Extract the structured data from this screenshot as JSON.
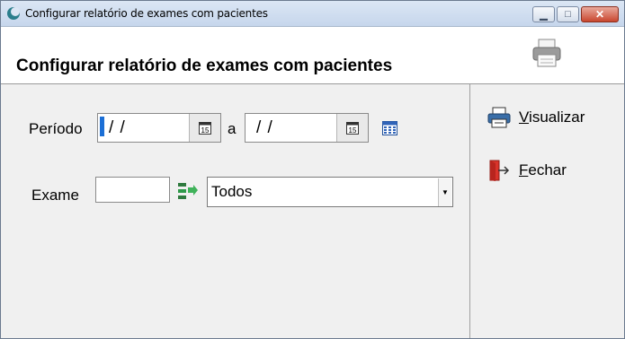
{
  "window": {
    "title": "Configurar relatório de exames com pacientes",
    "controls": {
      "minimize": "▁",
      "maximize": "□",
      "close": "✕"
    }
  },
  "header": {
    "title": "Configurar relatório de exames com pacientes",
    "icon": "printer-icon"
  },
  "form": {
    "periodo_label": "Período",
    "date_from_value": "/ /",
    "between_label": "a",
    "date_to_value": "/ /",
    "calendar_icon_day": "15",
    "exame_label": "Exame",
    "exame_code_value": "",
    "exame_select_value": "Todos"
  },
  "sidebar": {
    "visualizar": {
      "first": "V",
      "rest": "isualizar"
    },
    "fechar": {
      "first": "F",
      "rest": "echar"
    }
  },
  "colors": {
    "accent": "#1c6fd6",
    "titlebar": "#c6d6ec",
    "exit_red": "#d9342b",
    "green_icon": "#2e9a4a"
  }
}
